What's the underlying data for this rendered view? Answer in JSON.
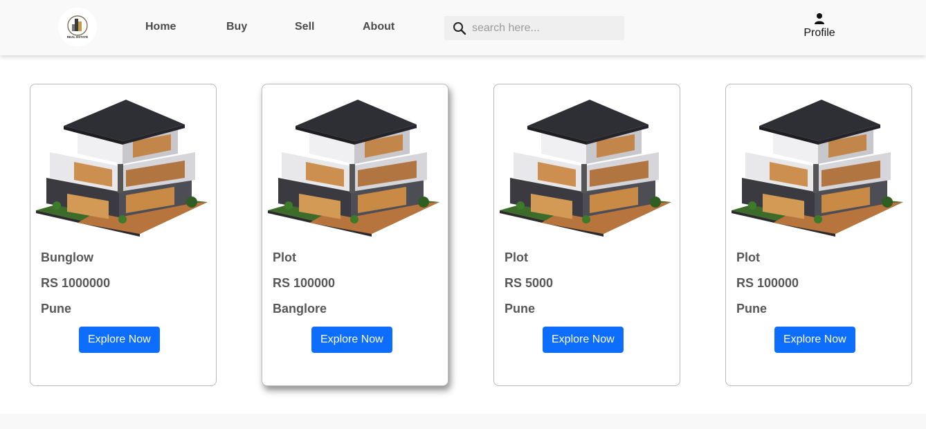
{
  "header": {
    "logo_text": "REAL ESTATE",
    "nav": [
      "Home",
      "Buy",
      "Sell",
      "About"
    ],
    "search_placeholder": "search here...",
    "profile_label": "Profile"
  },
  "listings": [
    {
      "type": "Bunglow",
      "price": "RS 1000000",
      "city": "Pune",
      "button": "Explore Now"
    },
    {
      "type": "Plot",
      "price": "RS 100000",
      "city": "Banglore",
      "button": "Explore Now"
    },
    {
      "type": "Plot",
      "price": "RS 5000",
      "city": "Pune",
      "button": "Explore Now"
    },
    {
      "type": "Plot",
      "price": "RS 100000",
      "city": "Pune",
      "button": "Explore Now"
    }
  ],
  "icons": {
    "search": "search-icon",
    "profile": "user-icon",
    "logo": "house-logo-icon"
  },
  "colors": {
    "button": "#0d6efd",
    "navbar": "#f9f9f9"
  }
}
